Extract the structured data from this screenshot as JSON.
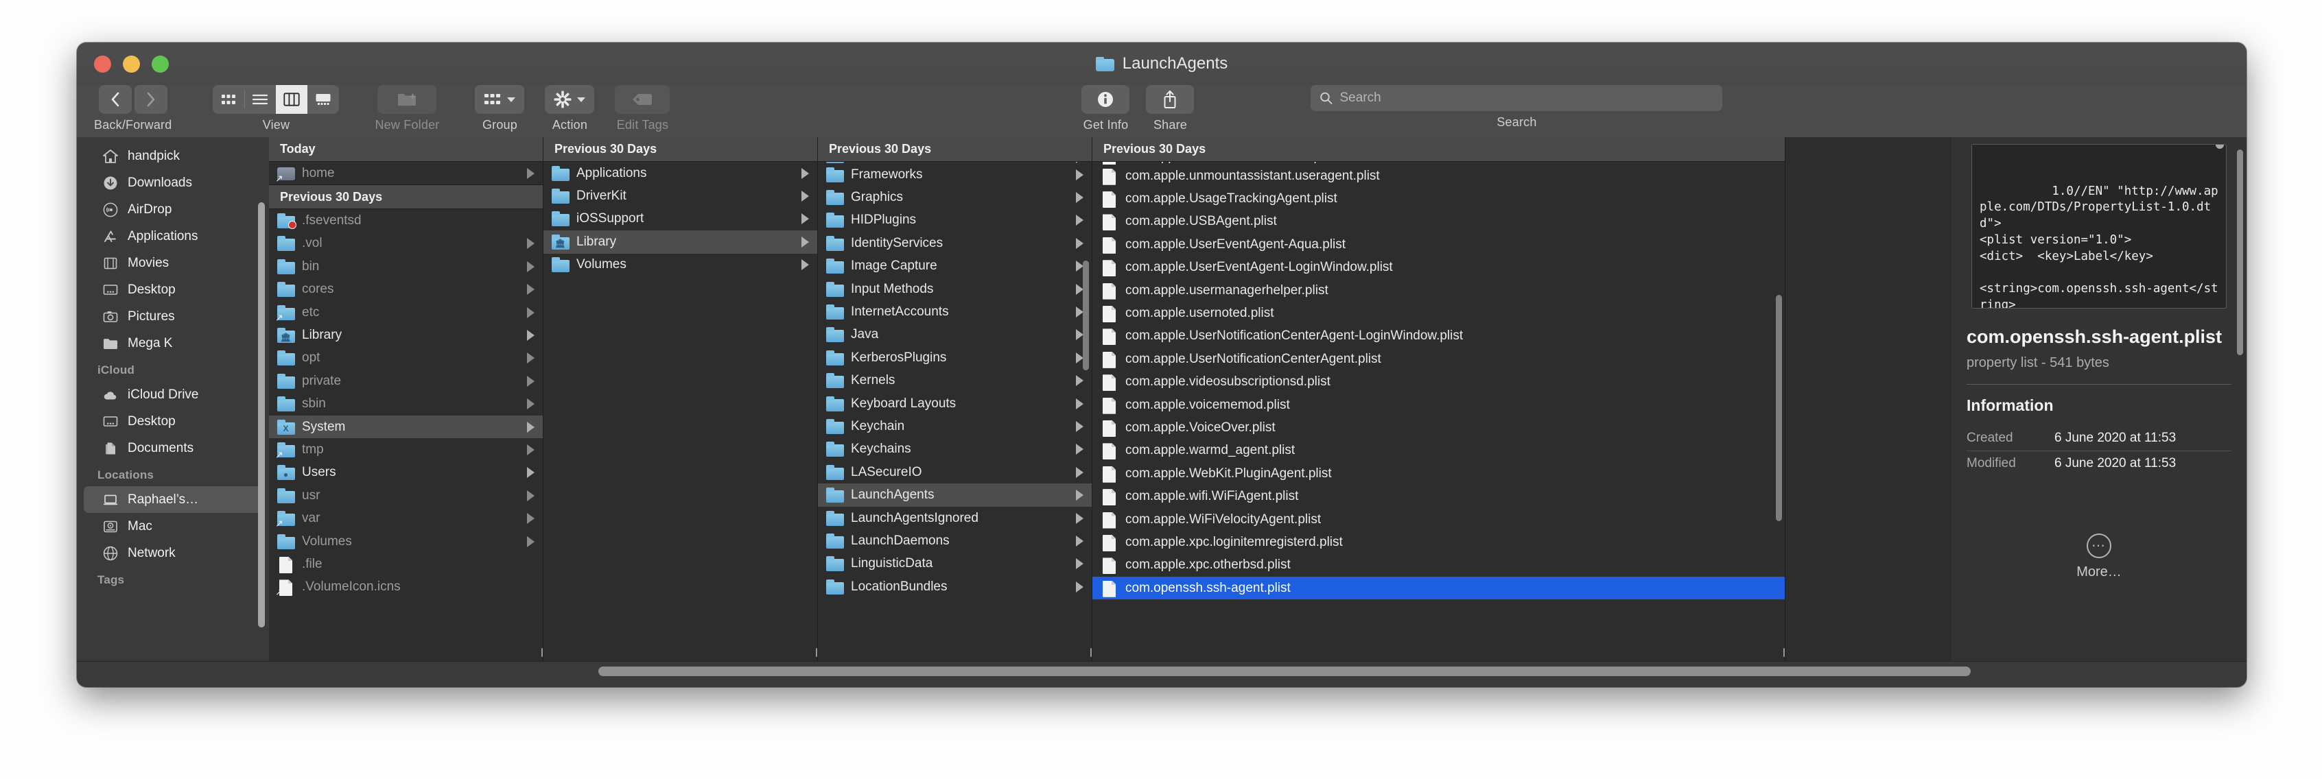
{
  "window": {
    "title": "LaunchAgents",
    "traffic_lights": [
      "close-red",
      "minimize-yellow",
      "zoom-green"
    ]
  },
  "toolbar": {
    "back_forward_label": "Back/Forward",
    "view_label": "View",
    "view_modes": [
      "icon-view",
      "list-view",
      "column-view",
      "gallery-view"
    ],
    "view_active_index": 2,
    "new_folder_label": "New Folder",
    "group_label": "Group",
    "action_label": "Action",
    "edit_tags_label": "Edit Tags",
    "get_info_label": "Get Info",
    "share_label": "Share",
    "search_label": "Search",
    "search_placeholder": "Search",
    "search_value": ""
  },
  "sidebar": {
    "groups": [
      {
        "header": "",
        "items": [
          {
            "label": "handpick",
            "icon": "home-icon",
            "selected": false
          },
          {
            "label": "Downloads",
            "icon": "downloads-icon",
            "selected": false
          },
          {
            "label": "AirDrop",
            "icon": "airdrop-icon",
            "selected": false
          },
          {
            "label": "Applications",
            "icon": "applications-icon",
            "selected": false
          },
          {
            "label": "Movies",
            "icon": "movies-icon",
            "selected": false
          },
          {
            "label": "Desktop",
            "icon": "desktop-icon",
            "selected": false
          },
          {
            "label": "Pictures",
            "icon": "pictures-icon",
            "selected": false
          },
          {
            "label": "Mega K",
            "icon": "folder-icon",
            "selected": false
          }
        ]
      },
      {
        "header": "iCloud",
        "items": [
          {
            "label": "iCloud Drive",
            "icon": "icloud-icon",
            "selected": false
          },
          {
            "label": "Desktop",
            "icon": "desktop-icon",
            "selected": false
          },
          {
            "label": "Documents",
            "icon": "documents-icon",
            "selected": false
          }
        ]
      },
      {
        "header": "Locations",
        "items": [
          {
            "label": "Raphael’s…",
            "icon": "laptop-icon",
            "selected": true
          },
          {
            "label": "Mac",
            "icon": "harddisk-icon",
            "selected": false
          },
          {
            "label": "Network",
            "icon": "network-icon",
            "selected": false
          }
        ]
      },
      {
        "header": "Tags",
        "items": []
      }
    ]
  },
  "columns": [
    {
      "name": "column-root",
      "header": "Today",
      "groups": [
        {
          "header": "Today",
          "rows": [
            {
              "label": "home",
              "icon": "disk-alias-icon",
              "arrow": true,
              "state": "dim"
            }
          ]
        },
        {
          "header": "Previous 30 Days",
          "rows": [
            {
              "label": ".fseventsd",
              "icon": "folder-noaccess-icon",
              "arrow": false,
              "state": "dim"
            },
            {
              "label": ".vol",
              "icon": "folder-icon",
              "arrow": true,
              "state": "dim"
            },
            {
              "label": "bin",
              "icon": "folder-icon",
              "arrow": true,
              "state": "dim"
            },
            {
              "label": "cores",
              "icon": "folder-icon",
              "arrow": true,
              "state": "dim"
            },
            {
              "label": "etc",
              "icon": "folder-alias-icon",
              "arrow": true,
              "state": "dim"
            },
            {
              "label": "Library",
              "icon": "folder-library-icon",
              "arrow": true,
              "state": "normal"
            },
            {
              "label": "opt",
              "icon": "folder-icon",
              "arrow": true,
              "state": "dim"
            },
            {
              "label": "private",
              "icon": "folder-icon",
              "arrow": true,
              "state": "dim"
            },
            {
              "label": "sbin",
              "icon": "folder-icon",
              "arrow": true,
              "state": "dim"
            },
            {
              "label": "System",
              "icon": "folder-system-icon",
              "arrow": true,
              "state": "selected-gray"
            },
            {
              "label": "tmp",
              "icon": "folder-alias-icon",
              "arrow": true,
              "state": "dim"
            },
            {
              "label": "Users",
              "icon": "folder-users-icon",
              "arrow": true,
              "state": "normal"
            },
            {
              "label": "usr",
              "icon": "folder-icon",
              "arrow": true,
              "state": "dim"
            },
            {
              "label": "var",
              "icon": "folder-alias-icon",
              "arrow": true,
              "state": "dim"
            },
            {
              "label": "Volumes",
              "icon": "folder-icon",
              "arrow": true,
              "state": "dim"
            },
            {
              "label": ".file",
              "icon": "doc-icon",
              "arrow": false,
              "state": "dim"
            },
            {
              "label": ".VolumeIcon.icns",
              "icon": "doc-alias-icon",
              "arrow": false,
              "state": "dim"
            }
          ]
        }
      ]
    },
    {
      "name": "column-system",
      "header": "Previous 30 Days",
      "groups": [
        {
          "header": "",
          "rows": [
            {
              "label": "Applications",
              "icon": "folder-icon",
              "arrow": true,
              "state": "normal"
            },
            {
              "label": "DriverKit",
              "icon": "folder-icon",
              "arrow": true,
              "state": "normal"
            },
            {
              "label": "iOSSupport",
              "icon": "folder-icon",
              "arrow": true,
              "state": "normal"
            },
            {
              "label": "Library",
              "icon": "folder-library-icon",
              "arrow": true,
              "state": "selected-gray"
            },
            {
              "label": "Volumes",
              "icon": "folder-icon",
              "arrow": true,
              "state": "normal"
            }
          ]
        }
      ]
    },
    {
      "name": "column-library",
      "header": "Previous 30 Days",
      "groups": [
        {
          "header": "",
          "rows": [
            {
              "label": "Fonts",
              "icon": "folder-icon",
              "arrow": true,
              "state": "normal",
              "clipped": true
            },
            {
              "label": "Frameworks",
              "icon": "folder-icon",
              "arrow": true,
              "state": "normal"
            },
            {
              "label": "Graphics",
              "icon": "folder-icon",
              "arrow": true,
              "state": "normal"
            },
            {
              "label": "HIDPlugins",
              "icon": "folder-icon",
              "arrow": true,
              "state": "normal"
            },
            {
              "label": "IdentityServices",
              "icon": "folder-icon",
              "arrow": true,
              "state": "normal"
            },
            {
              "label": "Image Capture",
              "icon": "folder-icon",
              "arrow": true,
              "state": "normal"
            },
            {
              "label": "Input Methods",
              "icon": "folder-icon",
              "arrow": true,
              "state": "normal"
            },
            {
              "label": "InternetAccounts",
              "icon": "folder-icon",
              "arrow": true,
              "state": "normal"
            },
            {
              "label": "Java",
              "icon": "folder-icon",
              "arrow": true,
              "state": "normal"
            },
            {
              "label": "KerberosPlugins",
              "icon": "folder-icon",
              "arrow": true,
              "state": "normal"
            },
            {
              "label": "Kernels",
              "icon": "folder-icon",
              "arrow": true,
              "state": "normal"
            },
            {
              "label": "Keyboard Layouts",
              "icon": "folder-icon",
              "arrow": true,
              "state": "normal"
            },
            {
              "label": "Keychain",
              "icon": "folder-icon",
              "arrow": true,
              "state": "normal"
            },
            {
              "label": "Keychains",
              "icon": "folder-icon",
              "arrow": true,
              "state": "normal"
            },
            {
              "label": "LASecureIO",
              "icon": "folder-icon",
              "arrow": true,
              "state": "normal"
            },
            {
              "label": "LaunchAgents",
              "icon": "folder-icon",
              "arrow": true,
              "state": "selected-gray"
            },
            {
              "label": "LaunchAgentsIgnored",
              "icon": "folder-icon",
              "arrow": true,
              "state": "normal"
            },
            {
              "label": "LaunchDaemons",
              "icon": "folder-icon",
              "arrow": true,
              "state": "normal"
            },
            {
              "label": "LinguisticData",
              "icon": "folder-icon",
              "arrow": true,
              "state": "normal"
            },
            {
              "label": "LocationBundles",
              "icon": "folder-icon",
              "arrow": true,
              "state": "normal"
            }
          ]
        }
      ]
    },
    {
      "name": "column-launchagents",
      "header": "Previous 30 Days",
      "groups": [
        {
          "header": "",
          "rows": [
            {
              "label": "com.apple.universalaccessHUD.plist",
              "icon": "doc-icon",
              "arrow": false,
              "state": "normal",
              "clipped": true
            },
            {
              "label": "com.apple.unmountassistant.useragent.plist",
              "icon": "doc-icon",
              "arrow": false,
              "state": "normal"
            },
            {
              "label": "com.apple.UsageTrackingAgent.plist",
              "icon": "doc-icon",
              "arrow": false,
              "state": "normal"
            },
            {
              "label": "com.apple.USBAgent.plist",
              "icon": "doc-icon",
              "arrow": false,
              "state": "normal"
            },
            {
              "label": "com.apple.UserEventAgent-Aqua.plist",
              "icon": "doc-icon",
              "arrow": false,
              "state": "normal"
            },
            {
              "label": "com.apple.UserEventAgent-LoginWindow.plist",
              "icon": "doc-icon",
              "arrow": false,
              "state": "normal"
            },
            {
              "label": "com.apple.usermanagerhelper.plist",
              "icon": "doc-icon",
              "arrow": false,
              "state": "normal"
            },
            {
              "label": "com.apple.usernoted.plist",
              "icon": "doc-icon",
              "arrow": false,
              "state": "normal"
            },
            {
              "label": "com.apple.UserNotificationCenterAgent-LoginWindow.plist",
              "icon": "doc-icon",
              "arrow": false,
              "state": "normal"
            },
            {
              "label": "com.apple.UserNotificationCenterAgent.plist",
              "icon": "doc-icon",
              "arrow": false,
              "state": "normal"
            },
            {
              "label": "com.apple.videosubscriptionsd.plist",
              "icon": "doc-icon",
              "arrow": false,
              "state": "normal"
            },
            {
              "label": "com.apple.voicememod.plist",
              "icon": "doc-icon",
              "arrow": false,
              "state": "normal"
            },
            {
              "label": "com.apple.VoiceOver.plist",
              "icon": "doc-icon",
              "arrow": false,
              "state": "normal"
            },
            {
              "label": "com.apple.warmd_agent.plist",
              "icon": "doc-icon",
              "arrow": false,
              "state": "normal"
            },
            {
              "label": "com.apple.WebKit.PluginAgent.plist",
              "icon": "doc-icon",
              "arrow": false,
              "state": "normal"
            },
            {
              "label": "com.apple.wifi.WiFiAgent.plist",
              "icon": "doc-icon",
              "arrow": false,
              "state": "normal"
            },
            {
              "label": "com.apple.WiFiVelocityAgent.plist",
              "icon": "doc-icon",
              "arrow": false,
              "state": "normal"
            },
            {
              "label": "com.apple.xpc.loginitemregisterd.plist",
              "icon": "doc-icon",
              "arrow": false,
              "state": "normal"
            },
            {
              "label": "com.apple.xpc.otherbsd.plist",
              "icon": "doc-icon",
              "arrow": false,
              "state": "normal"
            },
            {
              "label": "com.openssh.ssh-agent.plist",
              "icon": "doc-icon",
              "arrow": false,
              "state": "selected-blue"
            }
          ]
        }
      ]
    }
  ],
  "preview": {
    "quicklook_text": "1.0//EN\" \"http://www.apple.com/DTDs/PropertyList-1.0.dtd\">\n<plist version=\"1.0\">\n<dict>\t<key>Label</key>\n\n<string>com.openssh.ssh-agent</string>",
    "file_name": "com.openssh.ssh-agent.plist",
    "file_meta": "property list - 541 bytes",
    "information_header": "Information",
    "rows": [
      {
        "key": "Created",
        "value": "6 June 2020 at 11:53"
      },
      {
        "key": "Modified",
        "value": "6 June 2020 at 11:53"
      }
    ],
    "more_label": "More…"
  },
  "colors": {
    "selection_blue": "#1d5fe0",
    "selection_gray": "#4e4e4e",
    "window_chrome": "#4b4b4b",
    "column_bg": "#2d2d2d",
    "sidebar_bg": "#3a3a3a"
  }
}
